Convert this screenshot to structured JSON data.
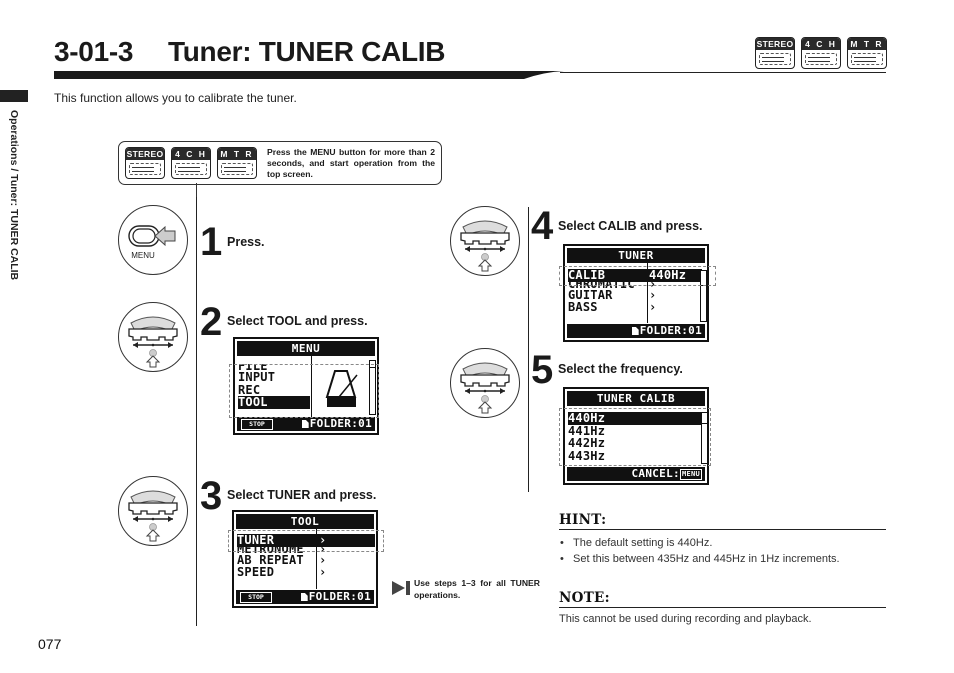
{
  "header": {
    "section_number": "3-01-3",
    "title": "Tuner: TUNER CALIB",
    "intro": "This function allows you to calibrate the tuner."
  },
  "mode_badges": [
    {
      "label": "STEREO",
      "icon": "stereo-mode-icon"
    },
    {
      "label": "4 C H",
      "icon": "4ch-mode-icon"
    },
    {
      "label": "M T R",
      "icon": "mtr-mode-icon"
    }
  ],
  "sidebar": {
    "breadcrumb": "Operations / Tuner: TUNER CALIB"
  },
  "callout": {
    "text": "Press the MENU button for more than 2 seconds, and start operation from the top screen."
  },
  "steps": [
    {
      "number": "1",
      "label": "Press.",
      "control": "MENU",
      "control_icon": "menu-button-icon"
    },
    {
      "number": "2",
      "label": "Select TOOL and press.",
      "control_icon": "dial-icon",
      "screen": {
        "title": "MENU",
        "rows": [
          "FILE",
          "INPUT",
          "REC",
          "TOOL"
        ],
        "selected": "TOOL",
        "footer_left": "STOP",
        "footer": "FOLDER:01",
        "graphic": "metronome-icon"
      }
    },
    {
      "number": "3",
      "label": "Select TUNER and press.",
      "control_icon": "dial-icon",
      "screen": {
        "title": "TOOL",
        "rows": [
          "TUNER",
          "METRONOME",
          "AB REPEAT",
          "SPEED"
        ],
        "values": [
          "›",
          "›",
          "›",
          "›"
        ],
        "selected": "TUNER",
        "footer_left": "STOP",
        "footer": "FOLDER:01"
      }
    },
    {
      "number": "4",
      "label": "Select CALIB and press.",
      "control_icon": "dial-icon",
      "screen": {
        "title": "TUNER",
        "rows": [
          "CALIB",
          "CHROMATIC",
          "GUITAR",
          "BASS"
        ],
        "values": [
          "440Hz",
          "›",
          "›",
          "›"
        ],
        "selected": "CALIB",
        "footer": "FOLDER:01"
      }
    },
    {
      "number": "5",
      "label": "Select the frequency.",
      "control_icon": "dial-icon",
      "screen": {
        "title": "TUNER CALIB",
        "rows": [
          "440Hz",
          "441Hz",
          "442Hz",
          "443Hz"
        ],
        "selected": "440Hz",
        "footer": "CANCEL:",
        "footer_key": "MENU"
      }
    }
  ],
  "note": {
    "text": "Use steps 1–3 for all TUNER operations."
  },
  "hint": {
    "heading": "HINT:",
    "items": [
      "The default setting is 440Hz.",
      "Set this between 435Hz and 445Hz in 1Hz increments."
    ]
  },
  "note_section": {
    "heading": "NOTE:",
    "body": "This cannot be used during recording and playback."
  },
  "page_number": "077"
}
